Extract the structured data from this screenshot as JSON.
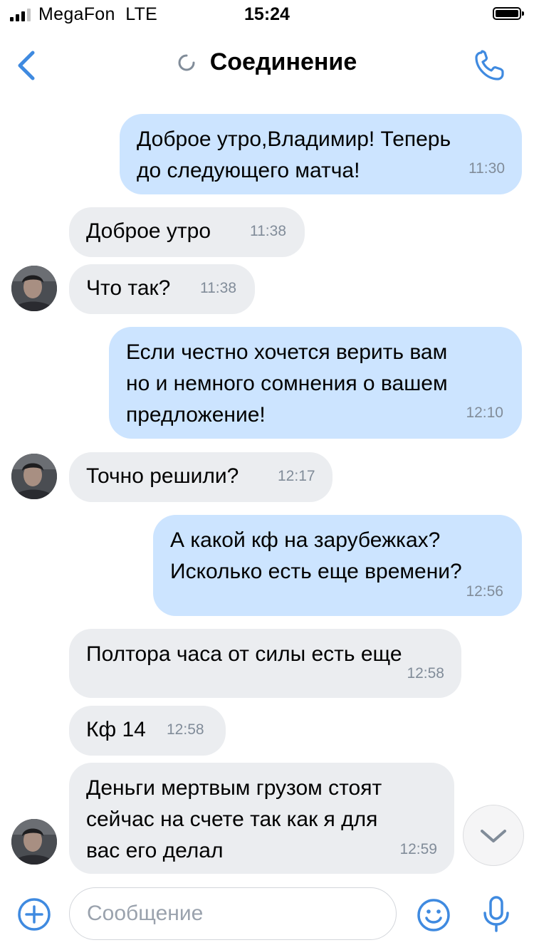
{
  "status_bar": {
    "carrier": "MegaFon",
    "network": "LTE",
    "time": "15:24"
  },
  "header": {
    "title": "Соединение",
    "back_icon": "chevron-left-icon",
    "call_icon": "phone-icon",
    "accent_color": "#3f8ae0"
  },
  "messages": [
    {
      "direction": "outgoing",
      "lines": [
        "Доброе утро,Владимир! Теперь",
        "до следующего матча!"
      ],
      "time": "11:30"
    },
    {
      "direction": "incoming",
      "lines": [
        "Доброе утро"
      ],
      "time": "11:38"
    },
    {
      "direction": "incoming",
      "lines": [
        "Что так?"
      ],
      "time": "11:38"
    },
    {
      "direction": "outgoing",
      "lines": [
        "Если честно хочется верить вам",
        "но и немного сомнения о вашем",
        "предложение!"
      ],
      "time": "12:10"
    },
    {
      "direction": "incoming",
      "lines": [
        "Точно решили?"
      ],
      "time": "12:17"
    },
    {
      "direction": "outgoing",
      "lines": [
        "А какой кф на зарубежках?",
        "Исколько есть еще времени?"
      ],
      "time": "12:56"
    },
    {
      "direction": "incoming",
      "lines": [
        "Полтора часа от силы есть еще"
      ],
      "time": "12:58"
    },
    {
      "direction": "incoming",
      "lines": [
        "Кф 14"
      ],
      "time": "12:58"
    },
    {
      "direction": "incoming",
      "lines": [
        "Деньги мертвым грузом стоят",
        "сейчас на счете так как я для",
        "вас его делал"
      ],
      "time": "12:59"
    }
  ],
  "composer": {
    "placeholder": "Сообщение",
    "attach_icon": "plus-circle-icon",
    "emoji_icon": "smile-icon",
    "voice_icon": "microphone-icon"
  },
  "colors": {
    "incoming_bubble": "#ebedf0",
    "outgoing_bubble": "#cce4ff",
    "timestamp": "#818c99"
  }
}
